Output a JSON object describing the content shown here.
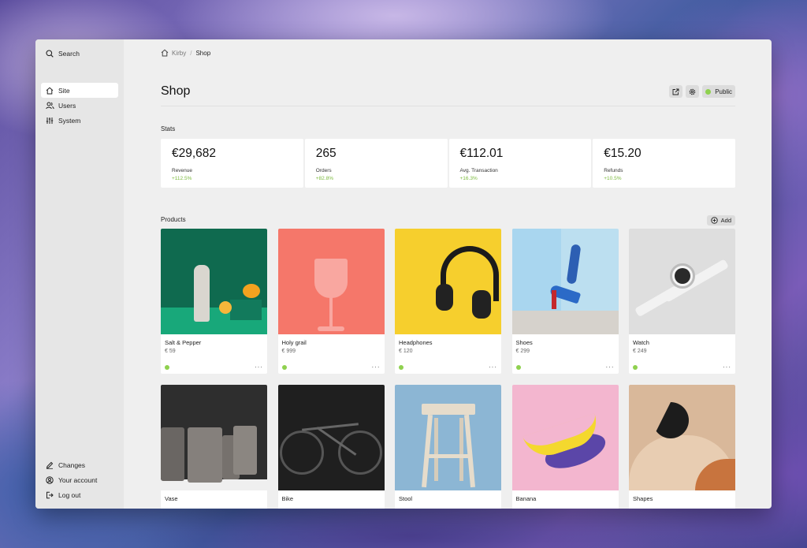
{
  "sidebar": {
    "search_label": "Search",
    "items": [
      {
        "label": "Site",
        "icon": "home-icon",
        "active": true
      },
      {
        "label": "Users",
        "icon": "users-icon",
        "active": false
      },
      {
        "label": "System",
        "icon": "sliders-icon",
        "active": false
      }
    ],
    "bottom_items": [
      {
        "label": "Changes",
        "icon": "pencil-icon"
      },
      {
        "label": "Your account",
        "icon": "account-icon"
      },
      {
        "label": "Log out",
        "icon": "logout-icon"
      }
    ]
  },
  "breadcrumb": {
    "root": "Kirby",
    "separator": "/",
    "current": "Shop"
  },
  "page": {
    "title": "Shop",
    "status_label": "Public",
    "status_color": "#8fd14f"
  },
  "stats": {
    "label": "Stats",
    "items": [
      {
        "value": "€29,682",
        "label": "Revenue",
        "change": "+112.5%"
      },
      {
        "value": "265",
        "label": "Orders",
        "change": "+82.8%"
      },
      {
        "value": "€112.01",
        "label": "Avg. Transaction",
        "change": "+16.3%"
      },
      {
        "value": "€15.20",
        "label": "Refunds",
        "change": "+10.5%"
      }
    ]
  },
  "products": {
    "label": "Products",
    "add_label": "Add",
    "items": [
      {
        "name": "Salt & Pepper",
        "price": "€ 59"
      },
      {
        "name": "Holy grail",
        "price": "€ 999"
      },
      {
        "name": "Headphones",
        "price": "€ 120"
      },
      {
        "name": "Shoes",
        "price": "€ 299"
      },
      {
        "name": "Watch",
        "price": "€ 249"
      },
      {
        "name": "Vase",
        "price": ""
      },
      {
        "name": "Bike",
        "price": ""
      },
      {
        "name": "Stool",
        "price": ""
      },
      {
        "name": "Banana",
        "price": ""
      },
      {
        "name": "Shapes",
        "price": ""
      }
    ]
  }
}
